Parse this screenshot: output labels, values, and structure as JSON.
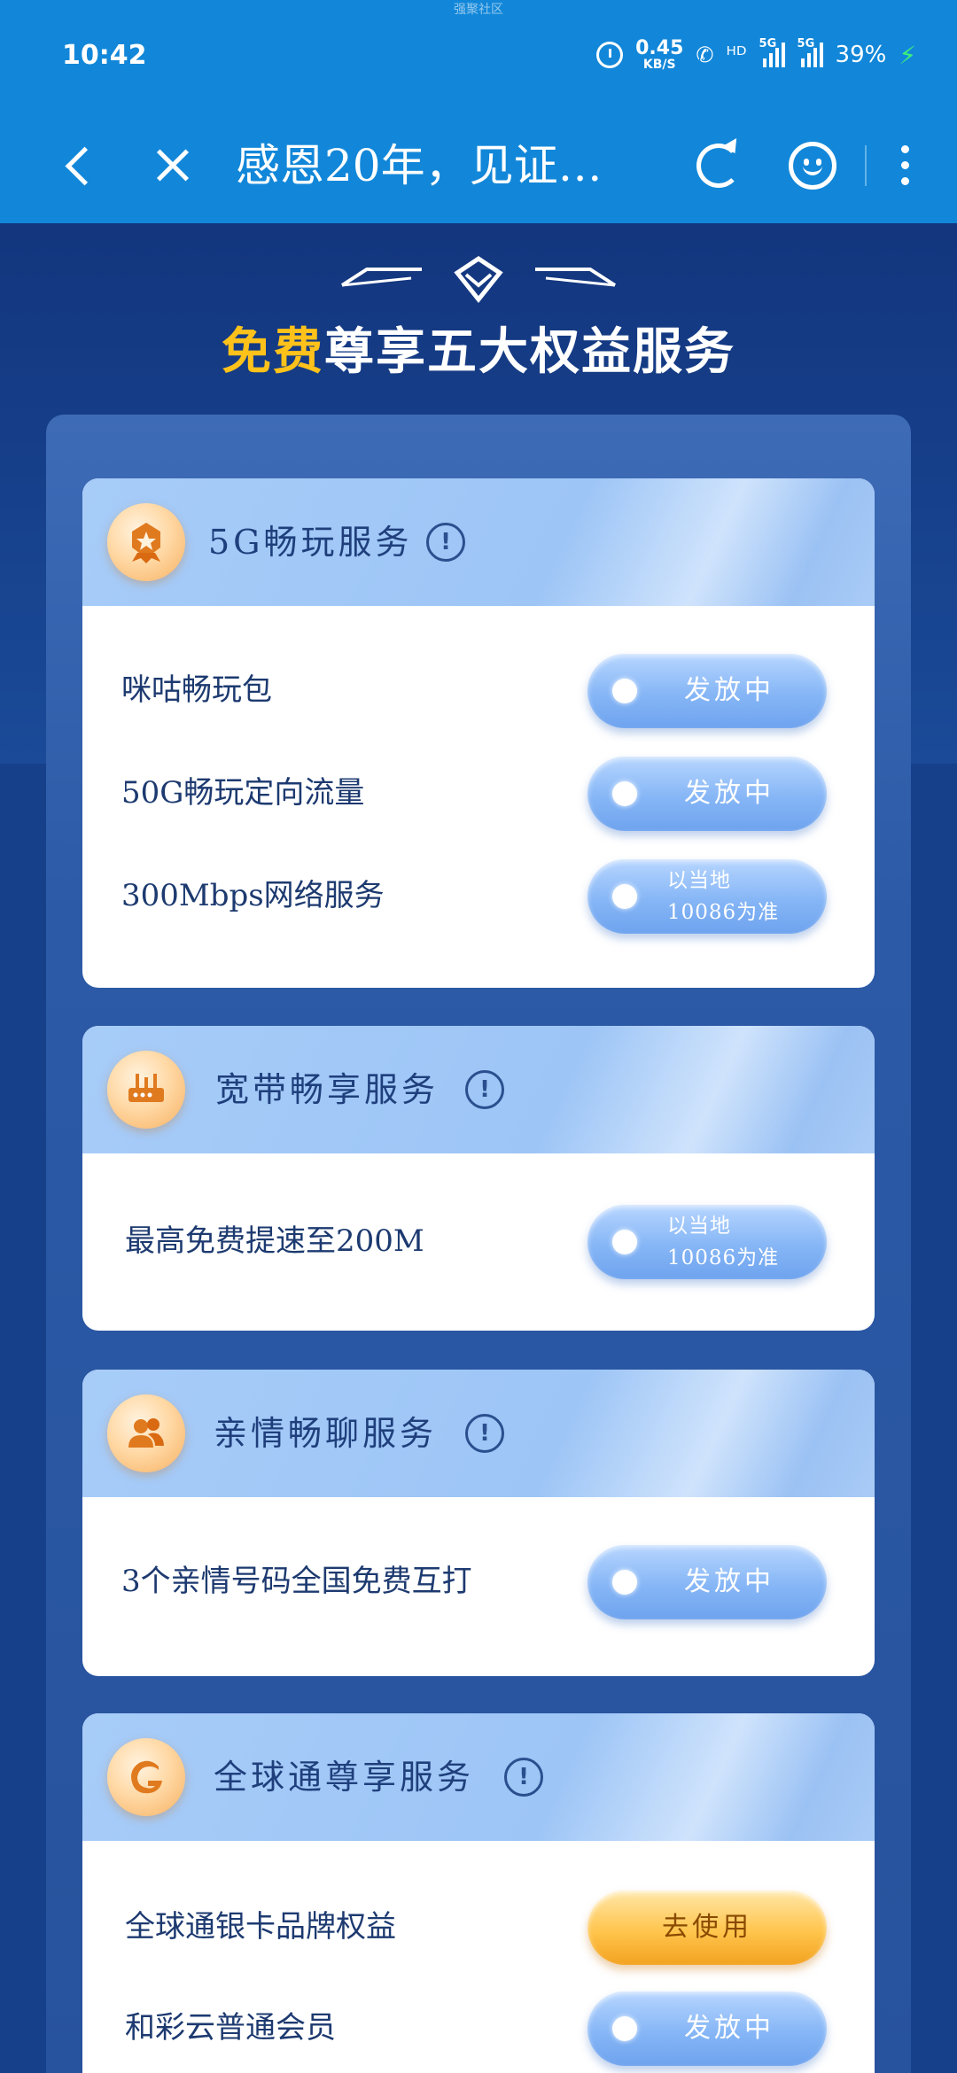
{
  "status_bar": {
    "watermark": "强聚社区",
    "time": "10:42",
    "net_speed_value": "0.45",
    "net_speed_unit": "KB/S",
    "call_icon": "✆",
    "hd_icon": "ᴴᴰ",
    "sim1_label": "5G",
    "sim2_label": "5G",
    "battery": "39%",
    "charging_icon": "⚡"
  },
  "title_bar": {
    "title": "感恩20年，见证…"
  },
  "header": {
    "title_highlight": "免费",
    "title_rest": "尊享五大权益服务"
  },
  "cards": [
    {
      "title": "5G畅玩服务",
      "icon": "medal-icon",
      "rows": [
        {
          "label": "咪咕畅玩包",
          "status": "发放中"
        },
        {
          "label": "50G畅玩定向流量",
          "status": "发放中"
        },
        {
          "label": "300Mbps网络服务",
          "status_line1": "以当地",
          "status_line2": "10086为准"
        }
      ]
    },
    {
      "title": "宽带畅享服务",
      "icon": "router-icon",
      "rows": [
        {
          "label": "最高免费提速至200M",
          "status_line1": "以当地",
          "status_line2": "10086为准"
        }
      ]
    },
    {
      "title": "亲情畅聊服务",
      "icon": "family-icon",
      "rows": [
        {
          "label": "3个亲情号码全国免费互打",
          "status": "发放中"
        }
      ]
    },
    {
      "title": "全球通尊享服务",
      "icon": "global-brand-icon",
      "rows": [
        {
          "label": "全球通银卡品牌权益",
          "action": "去使用"
        },
        {
          "label": "和彩云普通会员",
          "status": "发放中"
        }
      ]
    }
  ],
  "colors": {
    "status_bar_bg": "#1287d9",
    "page_bg": "#17408a",
    "highlight": "#ffc21a",
    "pill_blue": "#86b6f6",
    "pill_orange": "#ffc54d"
  }
}
